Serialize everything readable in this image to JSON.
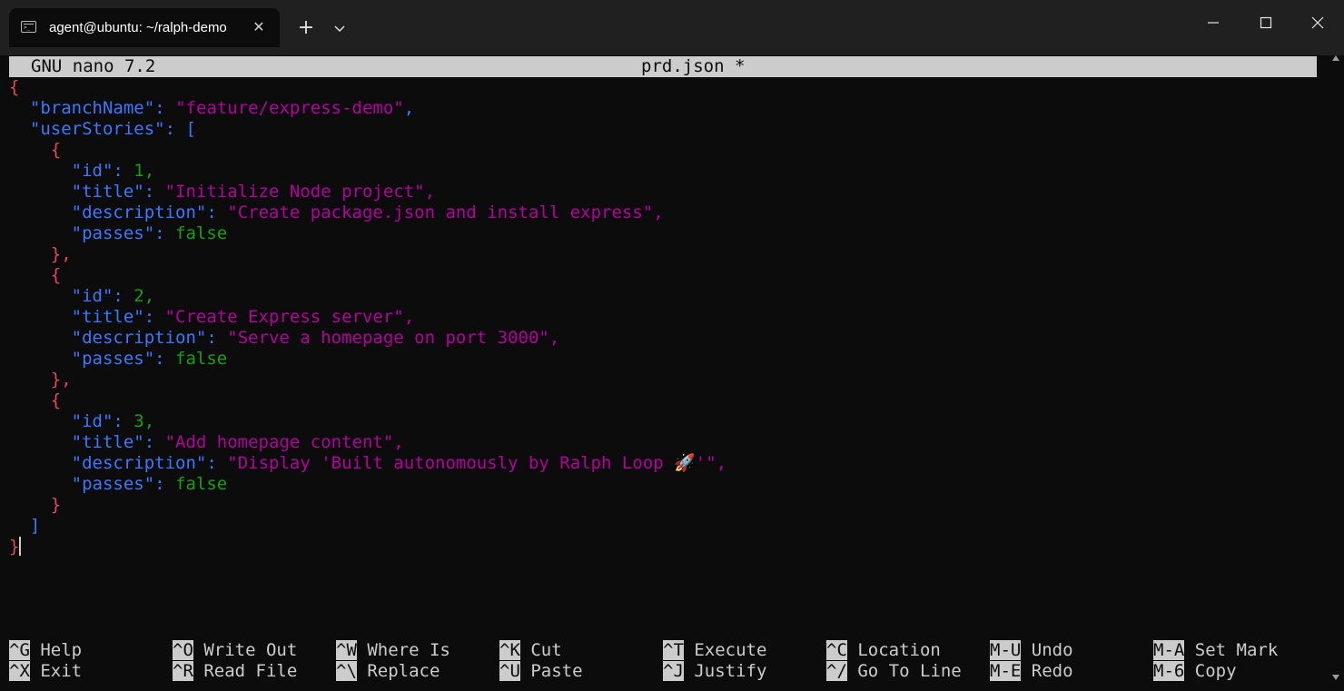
{
  "window": {
    "tab_title": "agent@ubuntu: ~/ralph-demo",
    "tab_icon_text": ">_",
    "close_tab_glyph": "✕",
    "new_tab_glyph": "+",
    "colors": {
      "titlebar": "#202020",
      "terminal_bg": "#0c0c0c",
      "foreground": "#cccccc",
      "json_key": "#3b78ff",
      "json_string": "#b4009e",
      "json_number_bool": "#13a10e",
      "json_brace": "#e74856"
    }
  },
  "nano": {
    "app": "GNU nano 7.2",
    "file": "prd.json *"
  },
  "editor_lines": [
    [
      {
        "t": "{",
        "c": "brace"
      }
    ],
    [
      {
        "t": "  "
      },
      {
        "t": "\"branchName\"",
        "c": "key"
      },
      {
        "t": ": ",
        "c": "punct"
      },
      {
        "t": "\"feature/express-demo\"",
        "c": "str"
      },
      {
        "t": ",",
        "c": "punct"
      }
    ],
    [
      {
        "t": "  "
      },
      {
        "t": "\"userStories\"",
        "c": "key"
      },
      {
        "t": ": ",
        "c": "punct"
      },
      {
        "t": "[",
        "c": "bracket"
      }
    ],
    [
      {
        "t": "    "
      },
      {
        "t": "{",
        "c": "brace"
      }
    ],
    [
      {
        "t": "      "
      },
      {
        "t": "\"id\"",
        "c": "key"
      },
      {
        "t": ": ",
        "c": "punct"
      },
      {
        "t": "1",
        "c": "num"
      },
      {
        "t": ",",
        "c": "num"
      }
    ],
    [
      {
        "t": "      "
      },
      {
        "t": "\"title\"",
        "c": "key"
      },
      {
        "t": ": ",
        "c": "punct"
      },
      {
        "t": "\"Initialize Node project\"",
        "c": "str"
      },
      {
        "t": ",",
        "c": "str"
      }
    ],
    [
      {
        "t": "      "
      },
      {
        "t": "\"description\"",
        "c": "key"
      },
      {
        "t": ": ",
        "c": "punct"
      },
      {
        "t": "\"Create package.json and install express\"",
        "c": "str"
      },
      {
        "t": ",",
        "c": "str"
      }
    ],
    [
      {
        "t": "      "
      },
      {
        "t": "\"passes\"",
        "c": "key"
      },
      {
        "t": ": ",
        "c": "punct"
      },
      {
        "t": "false",
        "c": "bool"
      }
    ],
    [
      {
        "t": "    "
      },
      {
        "t": "},",
        "c": "brace"
      }
    ],
    [
      {
        "t": "    "
      },
      {
        "t": "{",
        "c": "brace"
      }
    ],
    [
      {
        "t": "      "
      },
      {
        "t": "\"id\"",
        "c": "key"
      },
      {
        "t": ": ",
        "c": "punct"
      },
      {
        "t": "2",
        "c": "num"
      },
      {
        "t": ",",
        "c": "num"
      }
    ],
    [
      {
        "t": "      "
      },
      {
        "t": "\"title\"",
        "c": "key"
      },
      {
        "t": ": ",
        "c": "punct"
      },
      {
        "t": "\"Create Express server\"",
        "c": "str"
      },
      {
        "t": ",",
        "c": "str"
      }
    ],
    [
      {
        "t": "      "
      },
      {
        "t": "\"description\"",
        "c": "key"
      },
      {
        "t": ": ",
        "c": "punct"
      },
      {
        "t": "\"Serve a homepage on port 3000\"",
        "c": "str"
      },
      {
        "t": ",",
        "c": "str"
      }
    ],
    [
      {
        "t": "      "
      },
      {
        "t": "\"passes\"",
        "c": "key"
      },
      {
        "t": ": ",
        "c": "punct"
      },
      {
        "t": "false",
        "c": "bool"
      }
    ],
    [
      {
        "t": "    "
      },
      {
        "t": "},",
        "c": "brace"
      }
    ],
    [
      {
        "t": "    "
      },
      {
        "t": "{",
        "c": "brace"
      }
    ],
    [
      {
        "t": "      "
      },
      {
        "t": "\"id\"",
        "c": "key"
      },
      {
        "t": ": ",
        "c": "punct"
      },
      {
        "t": "3",
        "c": "num"
      },
      {
        "t": ",",
        "c": "num"
      }
    ],
    [
      {
        "t": "      "
      },
      {
        "t": "\"title\"",
        "c": "key"
      },
      {
        "t": ": ",
        "c": "punct"
      },
      {
        "t": "\"Add homepage content\"",
        "c": "str"
      },
      {
        "t": ",",
        "c": "str"
      }
    ],
    [
      {
        "t": "      "
      },
      {
        "t": "\"description\"",
        "c": "key"
      },
      {
        "t": ": ",
        "c": "punct"
      },
      {
        "t": "\"Display 'Built autonomously by Ralph Loop 🚀'\"",
        "c": "str"
      },
      {
        "t": ",",
        "c": "str"
      }
    ],
    [
      {
        "t": "      "
      },
      {
        "t": "\"passes\"",
        "c": "key"
      },
      {
        "t": ": ",
        "c": "punct"
      },
      {
        "t": "false",
        "c": "bool"
      }
    ],
    [
      {
        "t": "    "
      },
      {
        "t": "}",
        "c": "brace"
      }
    ],
    [
      {
        "t": "  "
      },
      {
        "t": "]",
        "c": "bracket"
      }
    ],
    [
      {
        "t": "}",
        "c": "brace"
      },
      {
        "cursor": true
      }
    ]
  ],
  "shortcuts": [
    {
      "key": "^G",
      "label": "Help"
    },
    {
      "key": "^X",
      "label": "Exit"
    },
    {
      "key": "^O",
      "label": "Write Out"
    },
    {
      "key": "^R",
      "label": "Read File"
    },
    {
      "key": "^W",
      "label": "Where Is"
    },
    {
      "key": "^\\",
      "label": "Replace"
    },
    {
      "key": "^K",
      "label": "Cut"
    },
    {
      "key": "^U",
      "label": "Paste"
    },
    {
      "key": "^T",
      "label": "Execute"
    },
    {
      "key": "^J",
      "label": "Justify"
    },
    {
      "key": "^C",
      "label": "Location"
    },
    {
      "key": "^/",
      "label": "Go To Line"
    },
    {
      "key": "M-U",
      "label": "Undo"
    },
    {
      "key": "M-E",
      "label": "Redo"
    },
    {
      "key": "M-A",
      "label": "Set Mark"
    },
    {
      "key": "M-6",
      "label": "Copy"
    }
  ]
}
